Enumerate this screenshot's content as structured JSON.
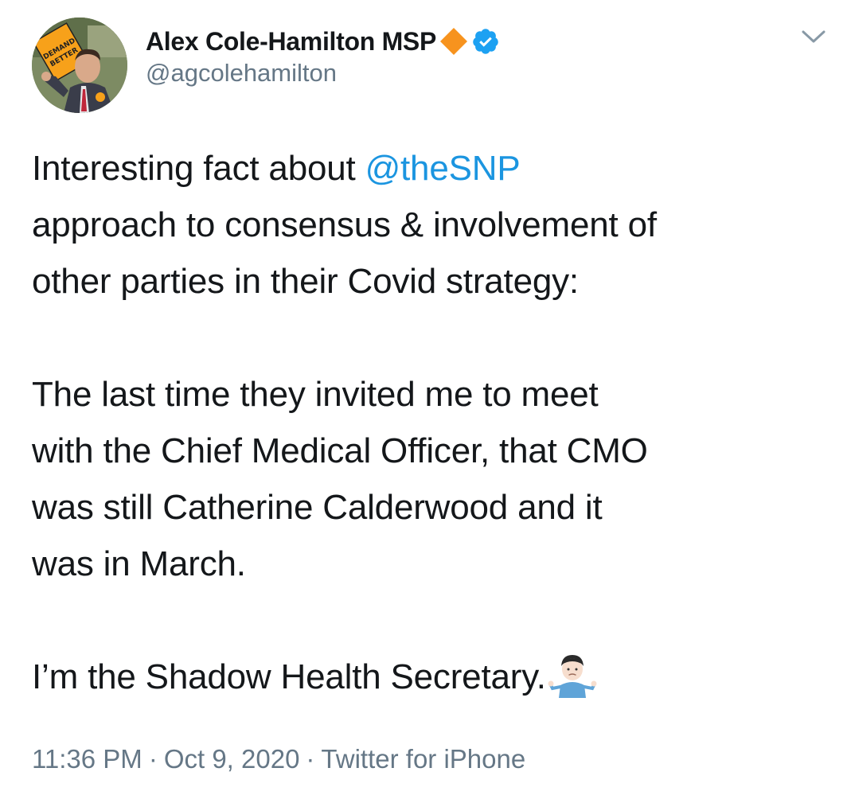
{
  "author": {
    "display_name": "Alex Cole-Hamilton MSP",
    "handle": "@agcolehamilton",
    "avatar_icon": "profile-photo",
    "party_icon": "orange-diamond-icon",
    "verified_icon": "verified-badge-icon",
    "avatar_sign_text": "DEMAND BETTER"
  },
  "menu": {
    "icon": "chevron-down-icon"
  },
  "tweet": {
    "line1_prefix": "Interesting fact about ",
    "mention": "@theSNP",
    "line2": "approach to consensus & involvement of",
    "line3": "other parties in their Covid strategy:",
    "line4": "The last time they invited me to meet",
    "line5": "with the Chief Medical Officer, that CMO",
    "line6": "was still Catherine Calderwood and it",
    "line7": "was in March.",
    "line8": "I’m the Shadow Health Secretary.",
    "emoji_icon": "man-shrugging-icon"
  },
  "meta": {
    "time": "11:36 PM",
    "separator": "·",
    "date": "Oct 9, 2020",
    "source": "Twitter for iPhone"
  },
  "colors": {
    "link": "#1b95e0",
    "secondary_text": "#657786",
    "primary_text": "#14171a",
    "verified": "#1da1f2",
    "party_orange": "#f7931e"
  }
}
